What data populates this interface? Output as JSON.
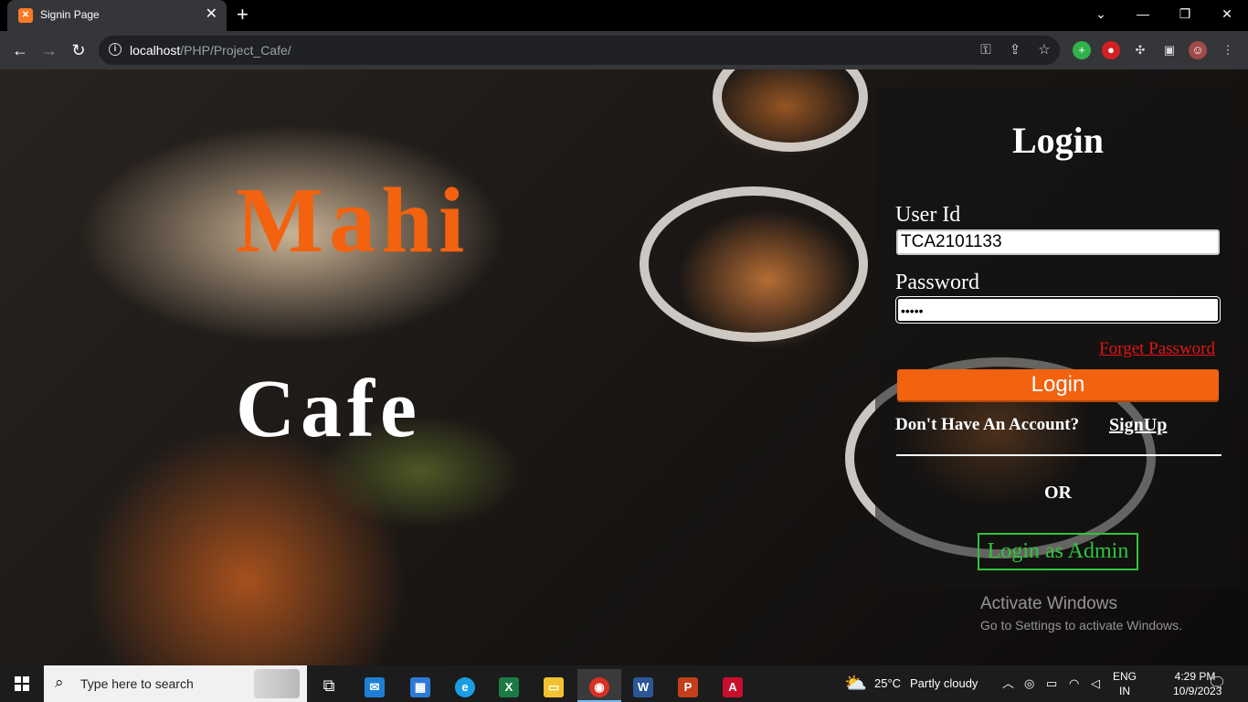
{
  "browser": {
    "tab_title": "Signin Page",
    "tab_favicon": "xampp-icon",
    "url_host": "localhost",
    "url_path": "/PHP/Project_Cafe/"
  },
  "brand": {
    "line1": "Mahi",
    "line2": "Cafe",
    "accent": "#f3620f"
  },
  "login": {
    "title": "Login",
    "userid_label": "User Id",
    "userid_value": "TCA2101133",
    "password_label": "Password",
    "password_value": "•••••",
    "forgot_label": "Forget Password",
    "submit_label": "Login",
    "no_account_text": "Don't Have An Account?",
    "signup_label": "SignUp",
    "or_text": "OR",
    "admin_label": "Login as Admin",
    "admin_color": "#2fc43b"
  },
  "watermark": {
    "title": "Activate Windows",
    "subtitle": "Go to Settings to activate Windows."
  },
  "taskbar": {
    "search_placeholder": "Type here to search",
    "weather_temp": "25°C",
    "weather_text": "Partly cloudy",
    "lang_1": "ENG",
    "lang_2": "IN",
    "time": "4:29 PM",
    "date": "10/9/2023"
  }
}
